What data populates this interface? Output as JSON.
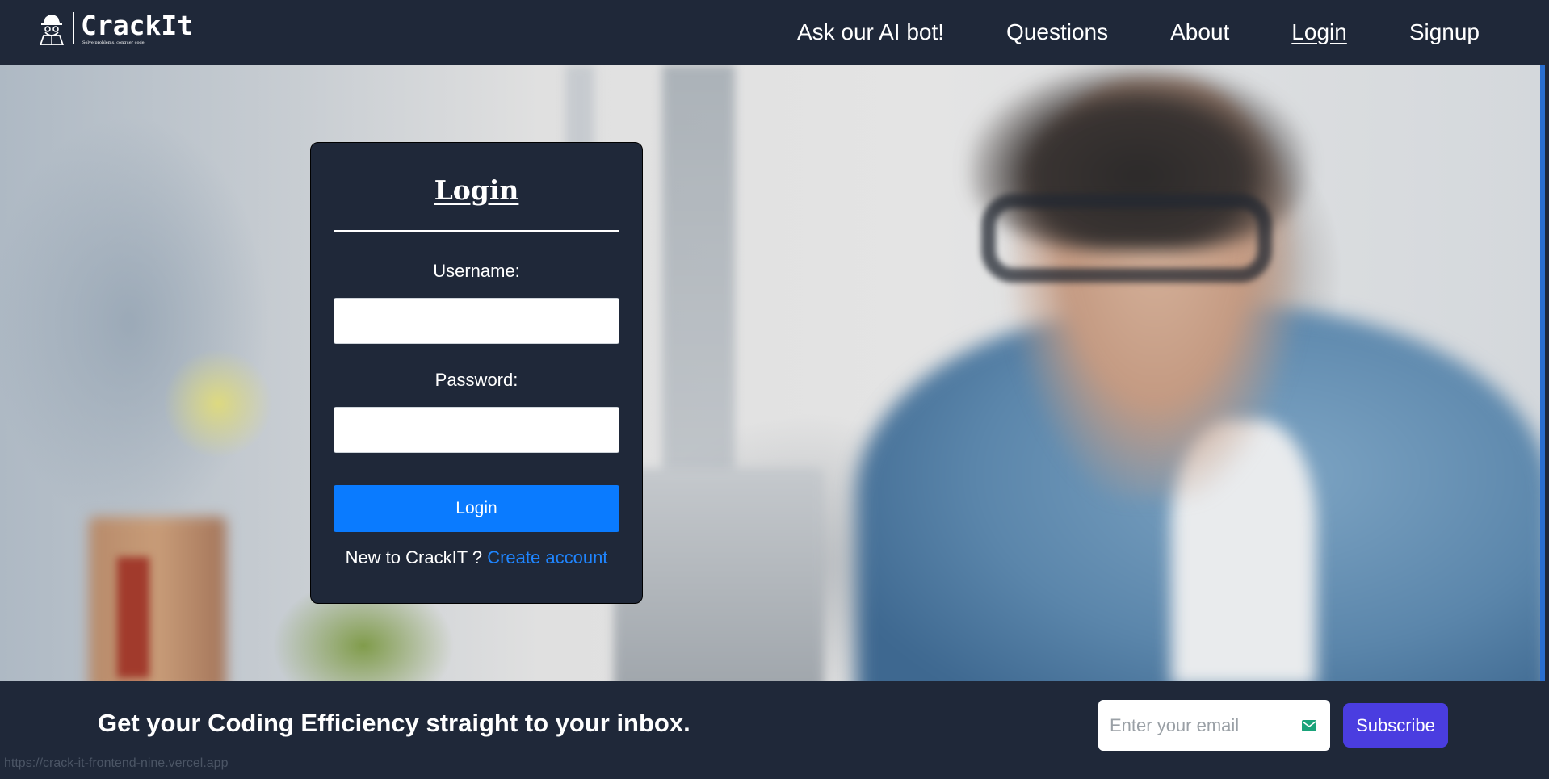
{
  "navbar": {
    "logo_text": "CrackIt",
    "logo_tagline": "Solve problems, conquer code",
    "links": [
      {
        "label": "Ask our AI bot!",
        "active": false
      },
      {
        "label": "Questions",
        "active": false
      },
      {
        "label": "About",
        "active": false
      },
      {
        "label": "Login",
        "active": true
      },
      {
        "label": "Signup",
        "active": false
      }
    ]
  },
  "login": {
    "title": "Login",
    "username_label": "Username:",
    "username_value": "",
    "password_label": "Password:",
    "password_value": "",
    "submit_label": "Login",
    "signup_prompt": "New to CrackIT ? ",
    "signup_link": "Create account"
  },
  "newsletter": {
    "text": "Get your Coding Efficiency straight to your inbox.",
    "email_placeholder": "Enter your email",
    "subscribe_label": "Subscribe"
  },
  "status_bar": {
    "url": "https://crack-it-frontend-nine.vercel.app"
  },
  "colors": {
    "background": "#1f2839",
    "primary_button": "#0a7bff",
    "link": "#1f85ff",
    "subscribe_button": "#4a3de0"
  }
}
